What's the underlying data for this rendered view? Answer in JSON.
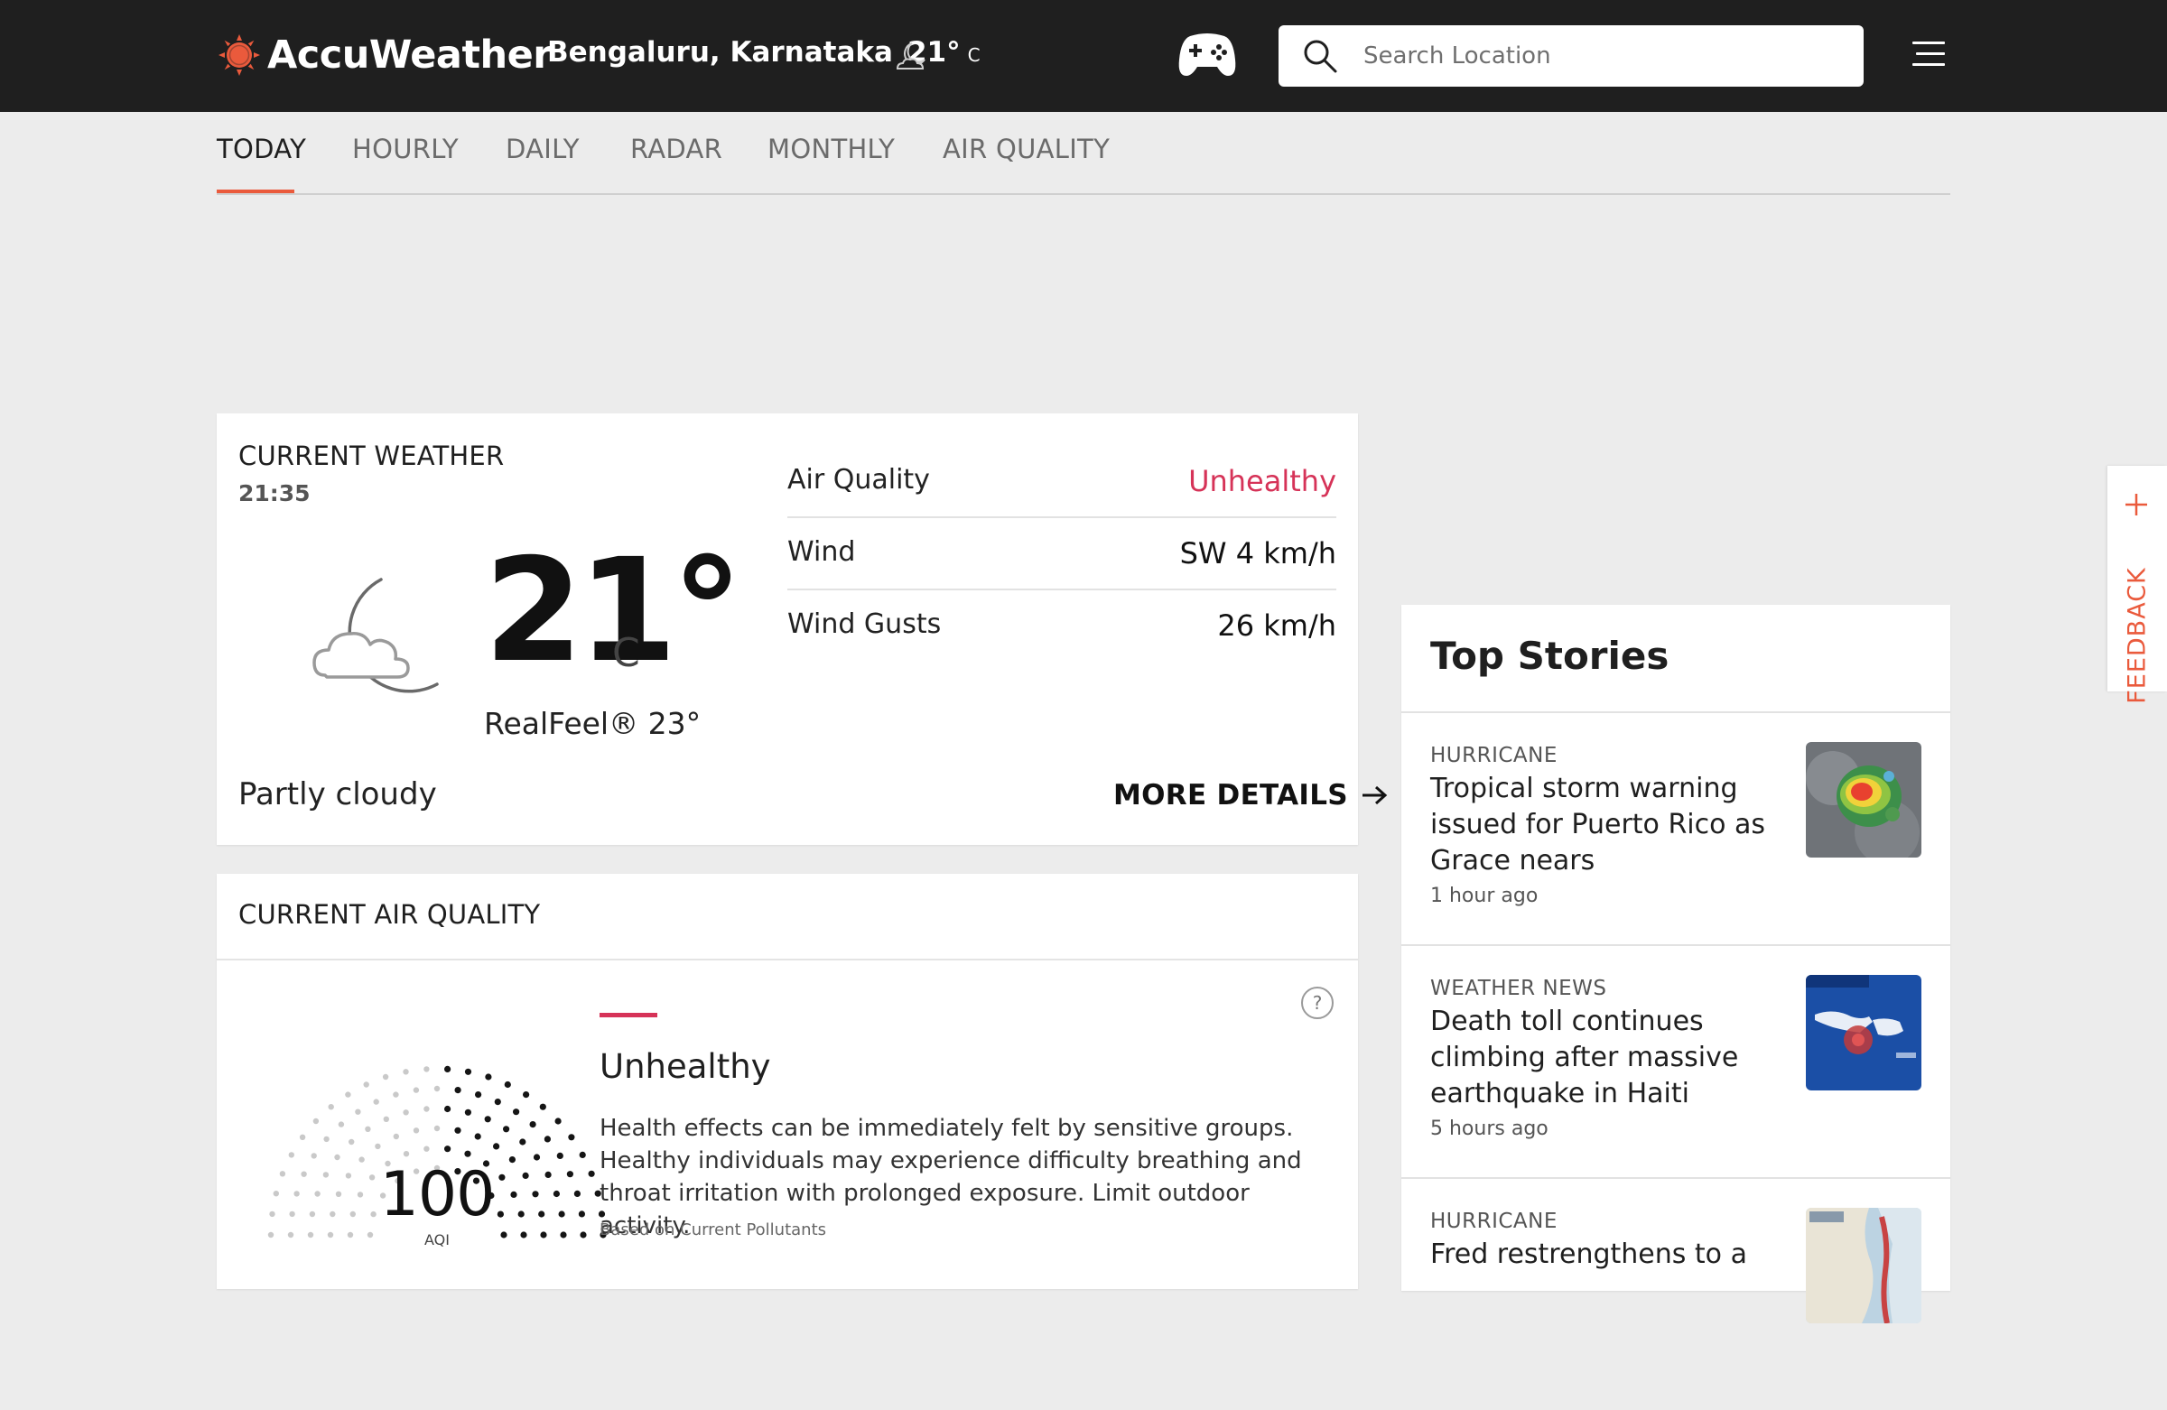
{
  "header": {
    "brand": "AccuWeather",
    "location": "Bengaluru, Karnataka",
    "temp": "21°",
    "unit": "C",
    "condition_icon": "moon-cloud-icon",
    "game_icon": "gamepad-icon",
    "search": {
      "placeholder": "Search Location",
      "value": ""
    },
    "menu_icon": "hamburger-menu-icon"
  },
  "nav": {
    "tabs": [
      {
        "label": "TODAY",
        "active": true
      },
      {
        "label": "HOURLY",
        "active": false
      },
      {
        "label": "DAILY",
        "active": false
      },
      {
        "label": "RADAR",
        "active": false
      },
      {
        "label": "MONTHLY",
        "active": false
      },
      {
        "label": "AIR QUALITY",
        "active": false
      }
    ],
    "accent_color": "#ea5a3c"
  },
  "current_weather": {
    "title": "CURRENT WEATHER",
    "time": "21:35",
    "icon": "partly-cloudy-night-icon",
    "temp": "21°",
    "unit": "C",
    "realfeel": "RealFeel® 23°",
    "phrase": "Partly cloudy",
    "details": [
      {
        "label": "Air Quality",
        "value": "Unhealthy",
        "status_color": "#d63358"
      },
      {
        "label": "Wind",
        "value": "SW 4 km/h"
      },
      {
        "label": "Wind Gusts",
        "value": "26 km/h"
      }
    ],
    "more_details": "MORE DETAILS"
  },
  "air_quality": {
    "title": "CURRENT AIR QUALITY",
    "aqi": "100",
    "aqi_label": "AQI",
    "category": "Unhealthy",
    "category_color": "#d63358",
    "description": "Health effects can be immediately felt by sensitive groups. Healthy individuals may experience difficulty breathing and throat irritation with prolonged exposure. Limit outdoor activity.",
    "note": "Based on Current Pollutants",
    "help_icon": "question-circle-icon"
  },
  "top_stories": {
    "title": "Top Stories",
    "items": [
      {
        "category": "HURRICANE",
        "title": "Tropical storm warning issued for Puerto Rico as Grace nears",
        "time": "1 hour ago",
        "thumb": "storm-radar-thumbnail"
      },
      {
        "category": "WEATHER NEWS",
        "title": "Death toll continues climbing after massive earthquake in Haiti",
        "time": "5 hours ago",
        "thumb": "haiti-map-thumbnail"
      },
      {
        "category": "HURRICANE",
        "title": "Fred restrengthens to a",
        "time": "",
        "thumb": "storm-track-map-thumbnail"
      }
    ]
  },
  "feedback": {
    "label": "FEEDBACK"
  }
}
